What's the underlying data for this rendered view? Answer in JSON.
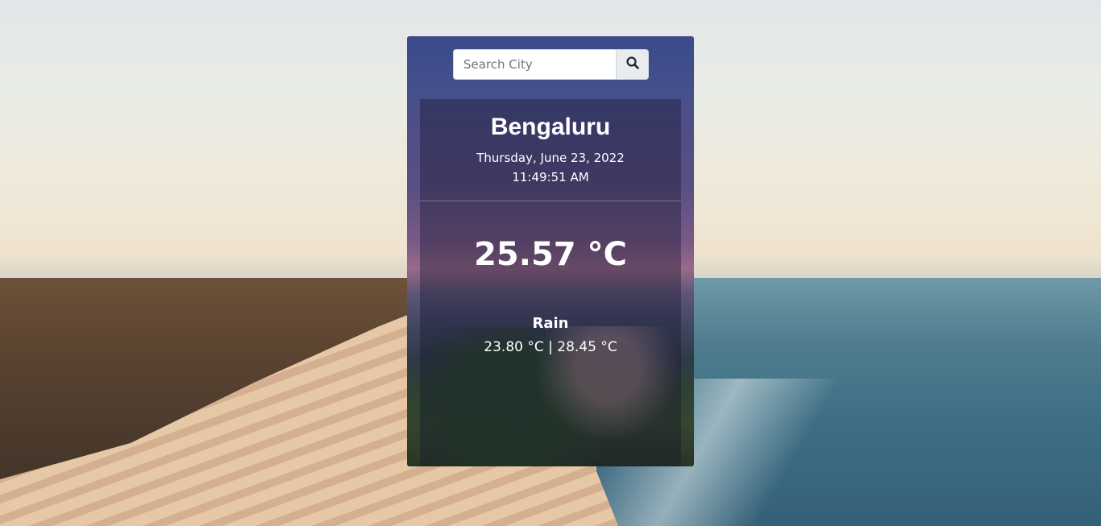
{
  "search": {
    "placeholder": "Search City",
    "value": "",
    "button_icon": "search-icon"
  },
  "weather": {
    "city": "Bengaluru",
    "date": "Thursday, June 23, 2022",
    "time": "11:49:51 AM",
    "temperature": "25.57 °C",
    "condition": "Rain",
    "min_max": "23.80 °C | 28.45 °C"
  }
}
